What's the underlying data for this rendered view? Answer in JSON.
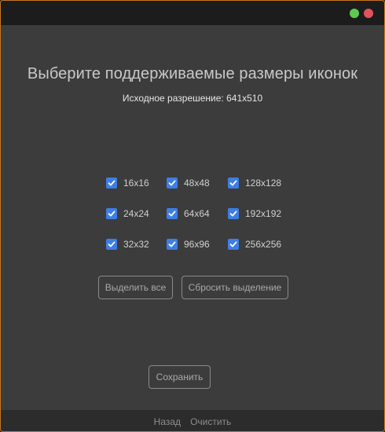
{
  "heading": "Выберите поддерживаемые размеры иконок",
  "source_resolution": "Исходное разрешение: 641x510",
  "sizes": [
    {
      "label": "16x16",
      "checked": true
    },
    {
      "label": "48x48",
      "checked": true
    },
    {
      "label": "128x128",
      "checked": true
    },
    {
      "label": "24x24",
      "checked": true
    },
    {
      "label": "64x64",
      "checked": true
    },
    {
      "label": "192x192",
      "checked": true
    },
    {
      "label": "32x32",
      "checked": true
    },
    {
      "label": "96x96",
      "checked": true
    },
    {
      "label": "256x256",
      "checked": true
    }
  ],
  "buttons": {
    "select_all": "Выделить все",
    "reset_selection": "Сбросить выделение",
    "save": "Сохранить"
  },
  "footer": {
    "back": "Назад",
    "clear": "Очистить"
  },
  "colors": {
    "accent_checkbox": "#3d7ee6",
    "window_border": "#c8761e",
    "traffic_green": "#5ec94f",
    "traffic_red": "#e2525a"
  },
  "icons": {
    "maximize": "green-circle-icon",
    "close": "red-circle-icon",
    "checkbox": "checkmark-icon"
  }
}
